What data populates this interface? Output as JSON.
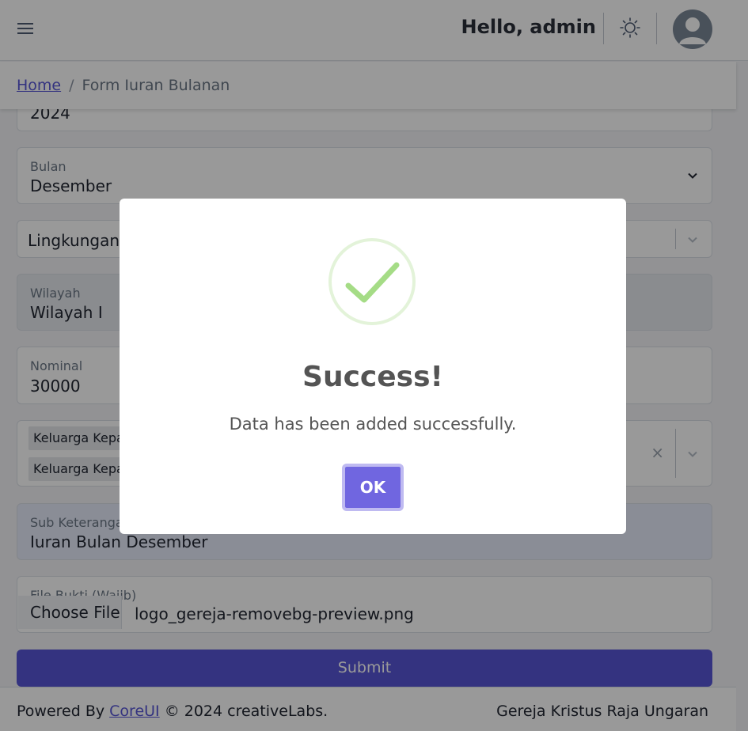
{
  "header": {
    "greeting": "Hello, admin",
    "menu_icon": "hamburger-icon",
    "theme_icon": "sun-icon",
    "avatar_icon": "user-avatar-icon"
  },
  "breadcrumb": {
    "home": "Home",
    "separator": "/",
    "current": "Form Iuran Bulanan"
  },
  "form": {
    "year_value": "2024",
    "bulan": {
      "label": "Bulan",
      "value": "Desember"
    },
    "lingkungan": {
      "value": "Lingkungan L"
    },
    "wilayah": {
      "label": "Wilayah",
      "value": "Wilayah I"
    },
    "nominal": {
      "label": "Nominal",
      "value": "30000"
    },
    "keluarga_chips": [
      "Keluarga Kepal",
      "Keluarga Kepal"
    ],
    "clear_glyph": "×",
    "sub_keterangan": {
      "label": "Sub Keterangan",
      "value": "Iuran Bulan Desember"
    },
    "file_bukti": {
      "label": "File Bukti (Wajib)",
      "button": "Choose File",
      "file_name": "logo_gereja-removebg-preview.png"
    },
    "submit_label": "Submit"
  },
  "footer": {
    "powered_by": "Powered By",
    "coreui": "CoreUI",
    "copyright": "© 2024 creativeLabs.",
    "church": "Gereja Kristus Raja Ungaran"
  },
  "modal": {
    "icon": "success-check-icon",
    "title": "Success!",
    "message": "Data has been added successfully.",
    "ok_label": "OK"
  },
  "colors": {
    "primary": "#5856d6",
    "ok_button": "#7066e0",
    "success_check": "#a5dc86"
  }
}
